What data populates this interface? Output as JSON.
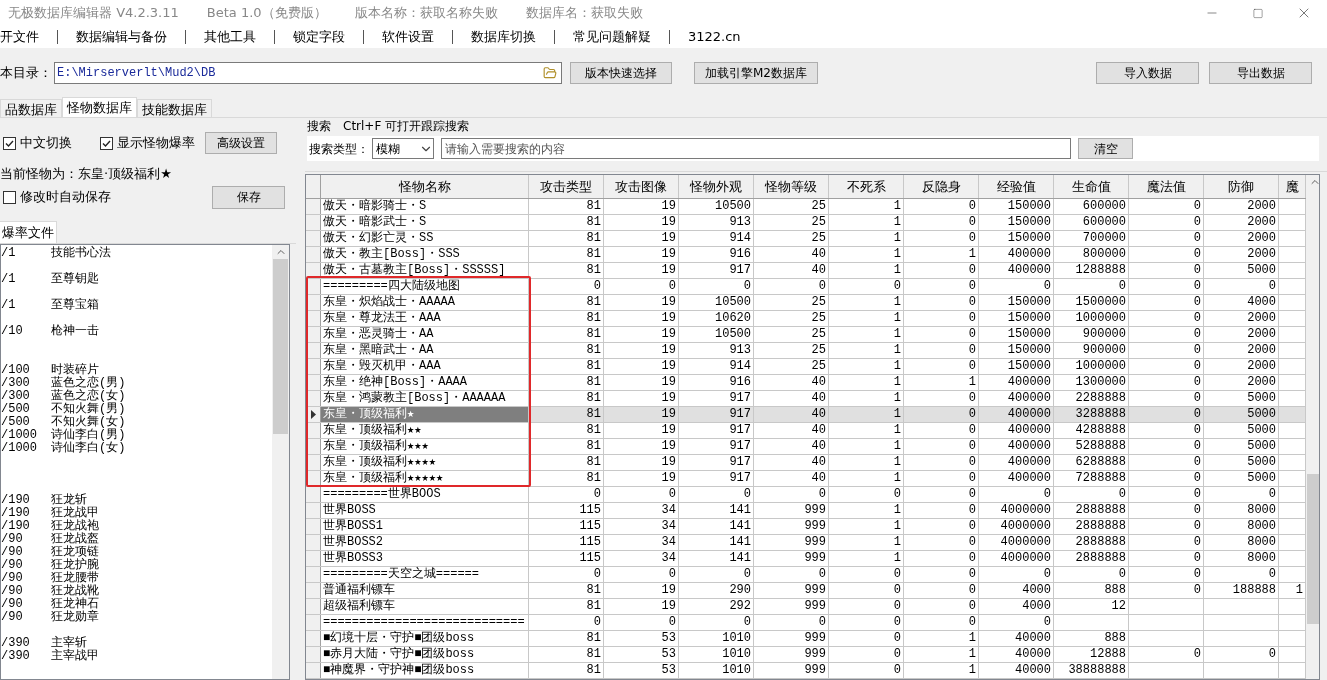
{
  "window": {
    "title": "无极数据库编辑器 V4.2.3.11",
    "edition": "Beta 1.0（免费版）",
    "version_name": "版本名称：获取名称失败",
    "db_name": "数据库名：获取失败"
  },
  "menu": [
    "开文件",
    "数据编辑与备份",
    "其他工具",
    "锁定字段",
    "软件设置",
    "数据库切换",
    "常见问题解疑",
    "3122.cn"
  ],
  "path_bar": {
    "label": "本目录：",
    "value": "E:\\Mirserverlt\\Mud2\\DB",
    "buttons": [
      "版本快速选择",
      "加载引擎M2数据库"
    ],
    "right_buttons": [
      "导入数据",
      "导出数据"
    ]
  },
  "tabs": [
    {
      "label": "品数据库",
      "selected": false
    },
    {
      "label": "怪物数据库",
      "selected": true
    },
    {
      "label": "技能数据库",
      "selected": false
    }
  ],
  "options": [
    {
      "label": "中文切换",
      "checked": true
    },
    {
      "label": "显示怪物爆率",
      "checked": true
    }
  ],
  "advanced_button": "高级设置",
  "search": {
    "legend": "搜索　Ctrl+F 可打开跟踪搜索",
    "type_label": "搜索类型：",
    "type_value": "模糊",
    "placeholder": "请输入需要搜索的内容",
    "clear_button": "清空"
  },
  "current_monster": "当前怪物为：东皇·顶级福利★",
  "auto_save": {
    "label": "修改时自动保存",
    "checked": false
  },
  "save_button": "保存",
  "drop_tab": {
    "label": "爆率文件",
    "selected": true
  },
  "drop_lines": [
    {
      "kind": "entry",
      "rate": "/1",
      "name": "技能书心法"
    },
    {
      "kind": "blank"
    },
    {
      "kind": "entry",
      "rate": "/1",
      "name": "至尊钥匙"
    },
    {
      "kind": "blank"
    },
    {
      "kind": "entry",
      "rate": "/1",
      "name": "至尊宝箱"
    },
    {
      "kind": "blank"
    },
    {
      "kind": "entry",
      "rate": "/10",
      "name": "枪神一击"
    },
    {
      "kind": "blank"
    },
    {
      "kind": "blank"
    },
    {
      "kind": "entry",
      "rate": "/100",
      "name": "时装碎片"
    },
    {
      "kind": "entry",
      "rate": "/300",
      "name": "蓝色之恋(男)"
    },
    {
      "kind": "entry",
      "rate": "/300",
      "name": "蓝色之恋(女)"
    },
    {
      "kind": "entry",
      "rate": "/500",
      "name": "不知火舞(男)"
    },
    {
      "kind": "entry",
      "rate": "/500",
      "name": "不知火舞(女)"
    },
    {
      "kind": "entry",
      "rate": "/1000",
      "name": "诗仙李白(男)"
    },
    {
      "kind": "entry",
      "rate": "/1000",
      "name": "诗仙李白(女)"
    },
    {
      "kind": "blank"
    },
    {
      "kind": "blank"
    },
    {
      "kind": "blank"
    },
    {
      "kind": "entry",
      "rate": "/190",
      "name": "狂龙斩"
    },
    {
      "kind": "entry",
      "rate": "/190",
      "name": "狂龙战甲"
    },
    {
      "kind": "entry",
      "rate": "/190",
      "name": "狂龙战袍"
    },
    {
      "kind": "entry",
      "rate": "/90",
      "name": "狂龙战盔"
    },
    {
      "kind": "entry",
      "rate": "/90",
      "name": "狂龙项链"
    },
    {
      "kind": "entry",
      "rate": "/90",
      "name": "狂龙护腕"
    },
    {
      "kind": "entry",
      "rate": "/90",
      "name": "狂龙腰带"
    },
    {
      "kind": "entry",
      "rate": "/90",
      "name": "狂龙战靴"
    },
    {
      "kind": "entry",
      "rate": "/90",
      "name": "狂龙神石"
    },
    {
      "kind": "entry",
      "rate": "/90",
      "name": "狂龙勋章"
    },
    {
      "kind": "blank"
    },
    {
      "kind": "entry",
      "rate": "/390",
      "name": "主宰斩"
    },
    {
      "kind": "entry",
      "rate": "/390",
      "name": "主宰战甲"
    }
  ],
  "table": {
    "columns": [
      "怪物名称",
      "攻击类型",
      "攻击图像",
      "怪物外观",
      "怪物等级",
      "不死系",
      "反隐身",
      "经验值",
      "生命值",
      "魔法值",
      "防御",
      "魔"
    ],
    "row_groups": [
      {
        "framed": false,
        "rows": [
          {
            "selected": false,
            "cells": [
              "傲天・暗影骑士・S",
              "81",
              "19",
              "10500",
              "25",
              "1",
              "0",
              "150000",
              "600000",
              "0",
              "2000"
            ]
          },
          {
            "selected": false,
            "cells": [
              "傲天・暗影武士・S",
              "81",
              "19",
              "913",
              "25",
              "1",
              "0",
              "150000",
              "600000",
              "0",
              "2000"
            ]
          },
          {
            "selected": false,
            "cells": [
              "傲天・幻影亡灵・SS",
              "81",
              "19",
              "914",
              "25",
              "1",
              "0",
              "150000",
              "700000",
              "0",
              "2000"
            ]
          },
          {
            "selected": false,
            "cells": [
              "傲天・教主[Boss]・SSS",
              "81",
              "19",
              "916",
              "40",
              "1",
              "1",
              "400000",
              "800000",
              "0",
              "2000"
            ]
          },
          {
            "selected": false,
            "cells": [
              "傲天・古墓教主[Boss]・SSSSS]",
              "81",
              "19",
              "917",
              "40",
              "1",
              "0",
              "400000",
              "1288888",
              "0",
              "5000"
            ]
          }
        ]
      },
      {
        "framed": true,
        "rows": [
          {
            "selected": false,
            "cells": [
              "=========四大陆级地图",
              "0",
              "0",
              "0",
              "0",
              "0",
              "0",
              "0",
              "0",
              "0",
              "0"
            ]
          },
          {
            "selected": false,
            "cells": [
              "东皇・炽焰战士・AAAAA",
              "81",
              "19",
              "10500",
              "25",
              "1",
              "0",
              "150000",
              "1500000",
              "0",
              "4000"
            ]
          },
          {
            "selected": false,
            "cells": [
              "东皇・尊龙法王・AAA",
              "81",
              "19",
              "10620",
              "25",
              "1",
              "0",
              "150000",
              "1000000",
              "0",
              "2000"
            ]
          },
          {
            "selected": false,
            "cells": [
              "东皇・恶灵骑士・AA",
              "81",
              "19",
              "10500",
              "25",
              "1",
              "0",
              "150000",
              "900000",
              "0",
              "2000"
            ]
          },
          {
            "selected": false,
            "cells": [
              "东皇・黑暗武士・AA",
              "81",
              "19",
              "913",
              "25",
              "1",
              "0",
              "150000",
              "900000",
              "0",
              "2000"
            ]
          },
          {
            "selected": false,
            "cells": [
              "东皇・毁灭机甲・AAA",
              "81",
              "19",
              "914",
              "25",
              "1",
              "0",
              "150000",
              "1000000",
              "0",
              "2000"
            ]
          },
          {
            "selected": false,
            "cells": [
              "东皇・绝神[Boss]・AAAA",
              "81",
              "19",
              "916",
              "40",
              "1",
              "1",
              "400000",
              "1300000",
              "0",
              "2000"
            ]
          },
          {
            "selected": false,
            "cells": [
              "东皇・鸿蒙教主[Boss]・AAAAAA",
              "81",
              "19",
              "917",
              "40",
              "1",
              "0",
              "400000",
              "2288888",
              "0",
              "5000"
            ]
          },
          {
            "selected": true,
            "cells": [
              "东皇・顶级福利★",
              "81",
              "19",
              "917",
              "40",
              "1",
              "0",
              "400000",
              "3288888",
              "0",
              "5000"
            ]
          },
          {
            "selected": false,
            "cells": [
              "东皇・顶级福利★★",
              "81",
              "19",
              "917",
              "40",
              "1",
              "0",
              "400000",
              "4288888",
              "0",
              "5000"
            ]
          },
          {
            "selected": false,
            "cells": [
              "东皇・顶级福利★★★",
              "81",
              "19",
              "917",
              "40",
              "1",
              "0",
              "400000",
              "5288888",
              "0",
              "5000"
            ]
          },
          {
            "selected": false,
            "cells": [
              "东皇・顶级福利★★★★",
              "81",
              "19",
              "917",
              "40",
              "1",
              "0",
              "400000",
              "6288888",
              "0",
              "5000"
            ]
          },
          {
            "selected": false,
            "cells": [
              "东皇・顶级福利★★★★★",
              "81",
              "19",
              "917",
              "40",
              "1",
              "0",
              "400000",
              "7288888",
              "0",
              "5000"
            ]
          }
        ]
      },
      {
        "framed": false,
        "rows": [
          {
            "selected": false,
            "cells": [
              "=========世界BOOS",
              "0",
              "0",
              "0",
              "0",
              "0",
              "0",
              "0",
              "0",
              "0",
              "0"
            ]
          },
          {
            "selected": false,
            "cells": [
              "世界BOSS",
              "115",
              "34",
              "141",
              "999",
              "1",
              "0",
              "4000000",
              "2888888",
              "0",
              "8000"
            ]
          },
          {
            "selected": false,
            "cells": [
              "世界BOSS1",
              "115",
              "34",
              "141",
              "999",
              "1",
              "0",
              "4000000",
              "2888888",
              "0",
              "8000"
            ]
          },
          {
            "selected": false,
            "cells": [
              "世界BOSS2",
              "115",
              "34",
              "141",
              "999",
              "1",
              "0",
              "4000000",
              "2888888",
              "0",
              "8000"
            ]
          },
          {
            "selected": false,
            "cells": [
              "世界BOSS3",
              "115",
              "34",
              "141",
              "999",
              "1",
              "0",
              "4000000",
              "2888888",
              "0",
              "8000"
            ]
          },
          {
            "selected": false,
            "cells": [
              "=========天空之城======",
              "0",
              "0",
              "0",
              "0",
              "0",
              "0",
              "0",
              "0",
              "0",
              "0"
            ]
          },
          {
            "selected": false,
            "cells": [
              "普通福利镖车",
              "81",
              "19",
              "290",
              "999",
              "0",
              "0",
              "4000",
              "888",
              "0",
              "188888",
              "1"
            ]
          },
          {
            "selected": false,
            "cells": [
              "超级福利镖车",
              "81",
              "19",
              "292",
              "999",
              "0",
              "0",
              "4000",
              "12",
              null,
              null
            ]
          },
          {
            "selected": false,
            "cells": [
              "============================",
              "0",
              "0",
              "0",
              "0",
              "0",
              "0",
              "0",
              null,
              null,
              null
            ]
          },
          {
            "selected": false,
            "cells": [
              "■幻境十层・守护■团级boss",
              "81",
              "53",
              "1010",
              "999",
              "0",
              "1",
              "40000",
              "888",
              null,
              null
            ]
          },
          {
            "selected": false,
            "cells": [
              "■赤月大陆・守护■团级boss",
              "81",
              "53",
              "1010",
              "999",
              "0",
              "1",
              "40000",
              "12888",
              "0",
              "0"
            ]
          },
          {
            "selected": false,
            "cells": [
              "■神魔界・守护神■团级boss",
              "81",
              "53",
              "1010",
              "999",
              "0",
              "1",
              "40000",
              "38888888",
              null,
              null
            ]
          }
        ]
      }
    ]
  }
}
